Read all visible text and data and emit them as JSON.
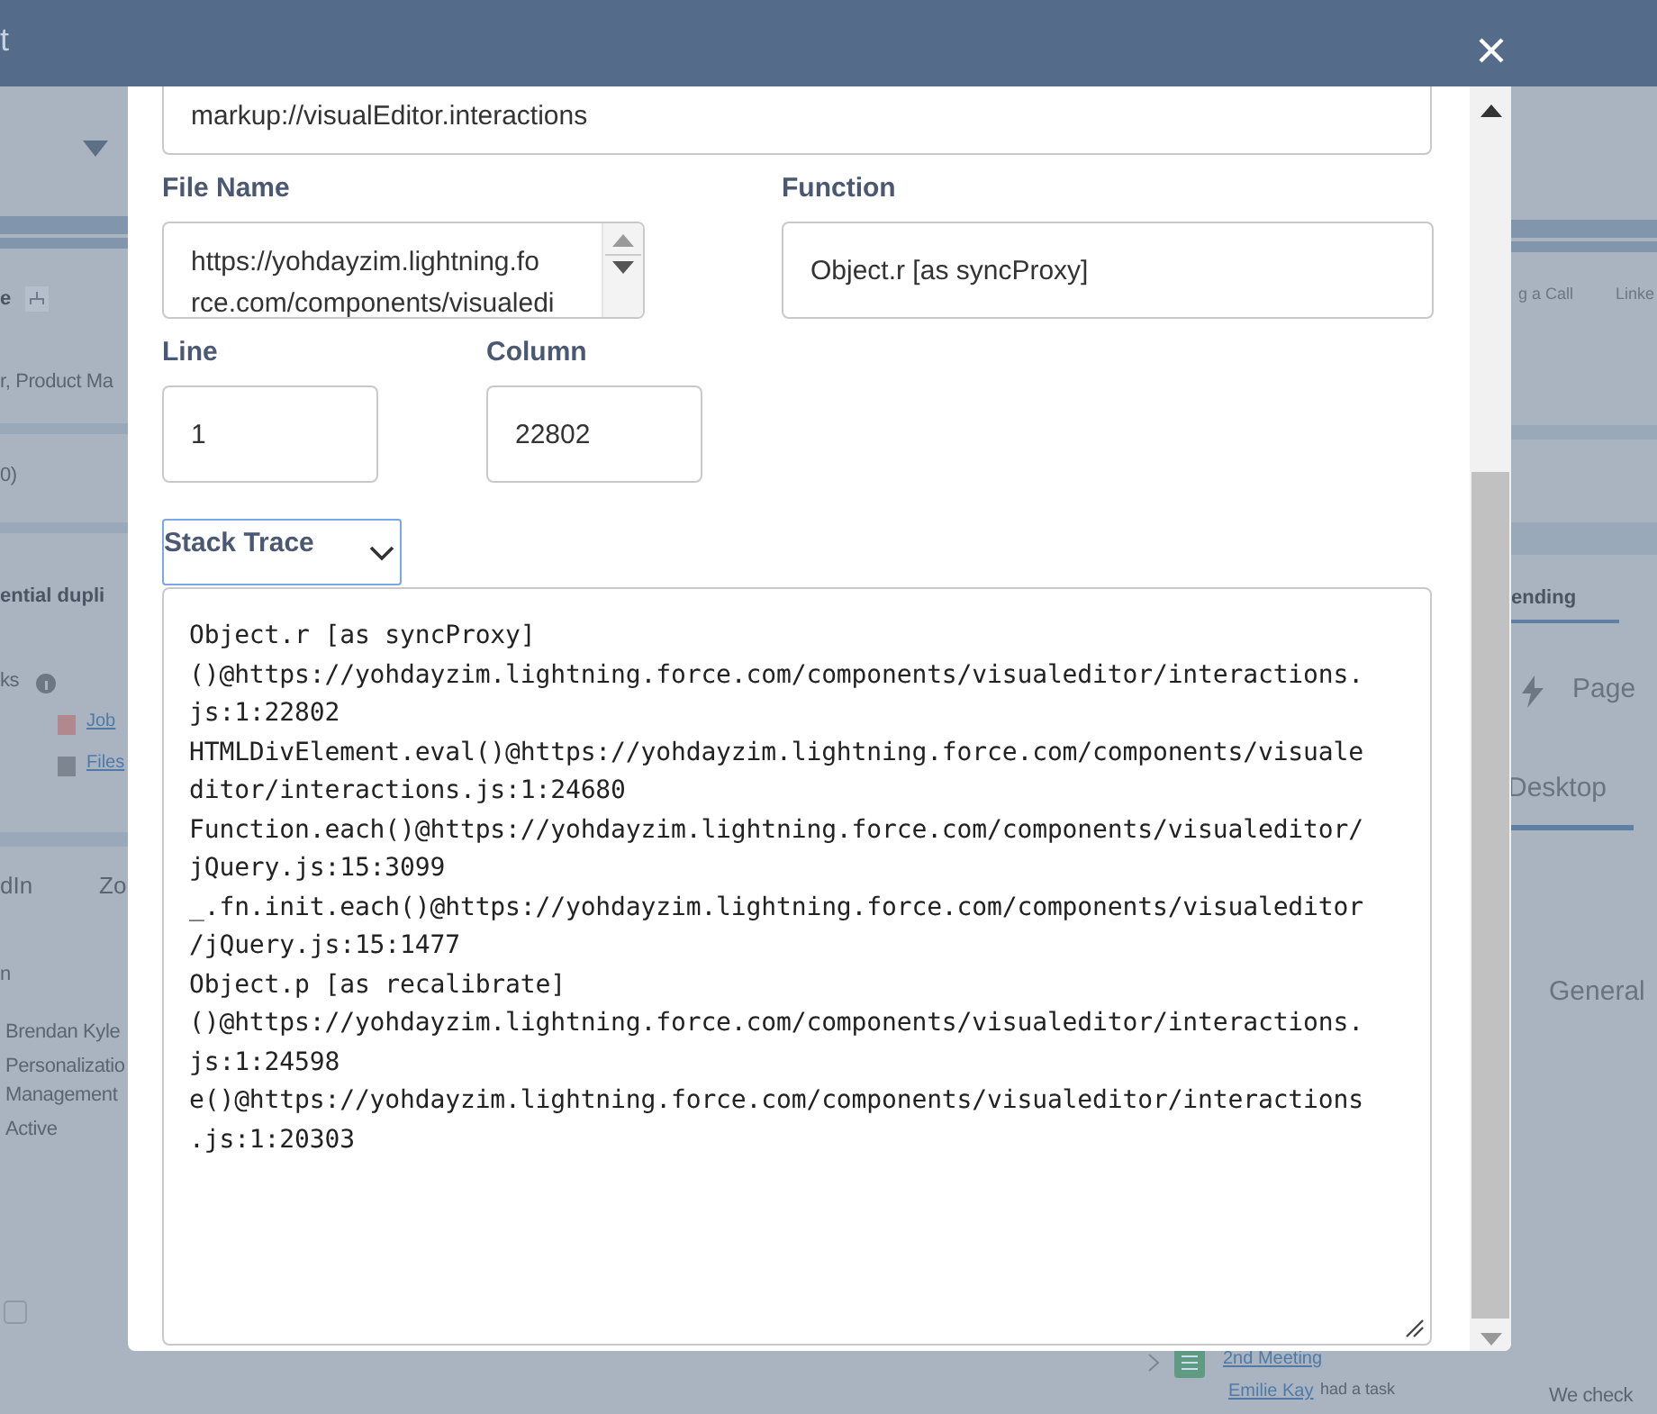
{
  "header": {
    "title": "t"
  },
  "background": {
    "items": [
      {
        "text": "e",
        "kind": "bold"
      },
      {
        "text": "r, Product Ma",
        "kind": "text"
      },
      {
        "text": "0)",
        "kind": "text"
      },
      {
        "text": "ential dupli",
        "kind": "bold"
      },
      {
        "text": "ks",
        "kind": "text"
      },
      {
        "text": "Job",
        "kind": "link"
      },
      {
        "text": "Files",
        "kind": "link"
      },
      {
        "text": "dIn",
        "kind": "tab"
      },
      {
        "text": "Zo",
        "kind": "tab"
      },
      {
        "text": "n",
        "kind": "text"
      },
      {
        "text": "Brendan Kyle",
        "kind": "text"
      },
      {
        "text": "Personalizatio",
        "kind": "text"
      },
      {
        "text": "Management",
        "kind": "text"
      },
      {
        "text": "Active",
        "kind": "text"
      },
      {
        "text": "g a Call",
        "kind": "button"
      },
      {
        "text": "Linke",
        "kind": "button"
      },
      {
        "text": "ending",
        "kind": "bold"
      },
      {
        "text": "Page",
        "kind": "big"
      },
      {
        "text": "Desktop",
        "kind": "big"
      },
      {
        "text": "General",
        "kind": "big"
      },
      {
        "text": "2nd Meeting",
        "kind": "link"
      },
      {
        "text": "Emilie Kay",
        "kind": "link"
      },
      {
        "text": "had a task",
        "kind": "small"
      },
      {
        "text": "We check",
        "kind": "text"
      }
    ]
  },
  "modal": {
    "top_field": {
      "value": "markup://visualEditor.interactions"
    },
    "file_name": {
      "label": "File Name",
      "value_lines": [
        "https://yohdayzim.lightning.fo",
        "rce.com/components/visualedi"
      ]
    },
    "function": {
      "label": "Function",
      "value": "Object.r [as syncProxy]"
    },
    "line": {
      "label": "Line",
      "value": "1"
    },
    "column": {
      "label": "Column",
      "value": "22802"
    },
    "stack_trace": {
      "dropdown": "Stack Trace",
      "lines": [
        "Object.r [as syncProxy]",
        "()@https://yohdayzim.lightning.force.com/components/visualeditor/interactions.",
        "js:1:22802",
        "HTMLDivElement.eval()@https://yohdayzim.lightning.force.com/components/visuale",
        "ditor/interactions.js:1:24680",
        "Function.each()@https://yohdayzim.lightning.force.com/components/visualeditor/",
        "jQuery.js:15:3099",
        "_.fn.init.each()@https://yohdayzim.lightning.force.com/components/visualeditor",
        "/jQuery.js:15:1477",
        "Object.p [as recalibrate]",
        "()@https://yohdayzim.lightning.force.com/components/visualeditor/interactions.",
        "js:1:24598",
        "e()@https://yohdayzim.lightning.force.com/components/visualeditor/interactions",
        ".js:1:20303"
      ]
    }
  }
}
